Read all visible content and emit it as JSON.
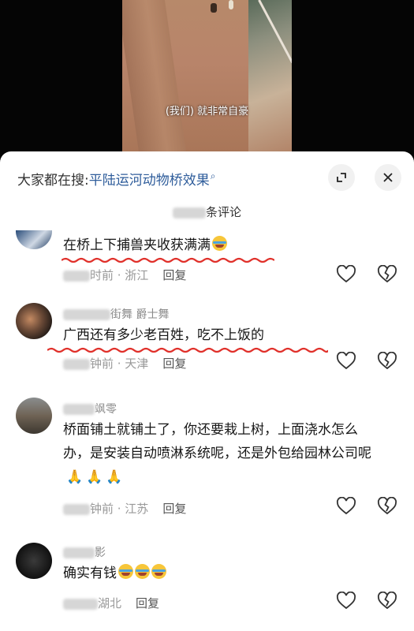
{
  "video": {
    "subtitle": "(我们) 就非常自豪"
  },
  "search_bar": {
    "prefix": "大家都在搜:",
    "query": "平陆运河动物桥效果"
  },
  "comment_count_label": "条评论",
  "comments": [
    {
      "username": "",
      "text": "在桥上下捕兽夹收获满满",
      "emoji_count": 1,
      "time": "时前 · 浙江",
      "reply_label": "回复"
    },
    {
      "username": "街舞 爵士舞",
      "text": "广西还有多少老百姓，吃不上饭的",
      "emoji_count": 0,
      "time": "钟前 · 天津",
      "reply_label": "回复"
    },
    {
      "username": "飒零",
      "text": "桥面铺土就铺土了，你还要栽上树，上面浇水怎么办，是安装自动喷淋系统呢，还是外包给园林公司呢",
      "emoji_count": 0,
      "pray_count": 3,
      "time": "钟前 · 江苏",
      "reply_label": "回复"
    },
    {
      "username": "影",
      "text": "确实有钱",
      "emoji_count": 3,
      "time": "湖北",
      "reply_label": "回复"
    }
  ],
  "colors": {
    "search_query": "#2f5d9b",
    "underline": "#e0302a",
    "meta": "#999999"
  }
}
